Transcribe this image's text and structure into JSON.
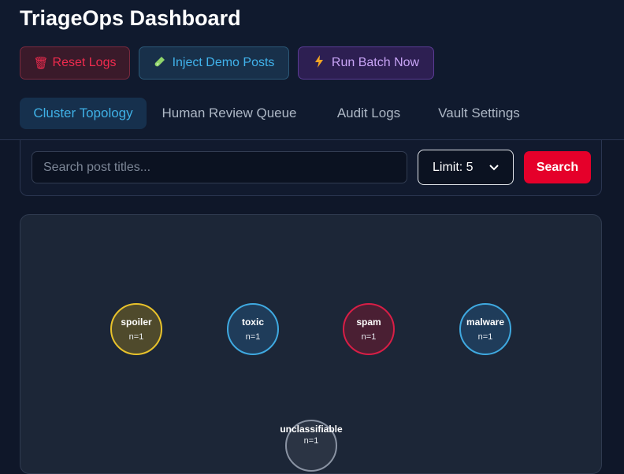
{
  "header": {
    "title": "TriageOps Dashboard"
  },
  "actions": {
    "reset_label": "Reset Logs",
    "inject_label": "Inject Demo Posts",
    "run_label": "Run Batch Now"
  },
  "tabs": [
    {
      "label": "Cluster Topology",
      "active": true
    },
    {
      "label": "Human Review Queue",
      "active": false
    },
    {
      "label": "Audit Logs",
      "active": false
    },
    {
      "label": "Vault Settings",
      "active": false
    }
  ],
  "search": {
    "placeholder": "Search post titles...",
    "value": "",
    "limit_label": "Limit: 5",
    "button_label": "Search"
  },
  "clusters": [
    {
      "label": "spoiler",
      "count": "n=1",
      "color": "#e8c22b",
      "fill": "#4f4a2c"
    },
    {
      "label": "toxic",
      "count": "n=1",
      "color": "#3fa9e0",
      "fill": "#1f3c5a"
    },
    {
      "label": "spam",
      "count": "n=1",
      "color": "#d81e46",
      "fill": "#4a1f33"
    },
    {
      "label": "malware",
      "count": "n=1",
      "color": "#3fa9e0",
      "fill": "#1f3c5a"
    },
    {
      "label": "unclassifiable",
      "count": "n=1",
      "color": "#8a93a3",
      "fill": "#2b3444"
    }
  ]
}
